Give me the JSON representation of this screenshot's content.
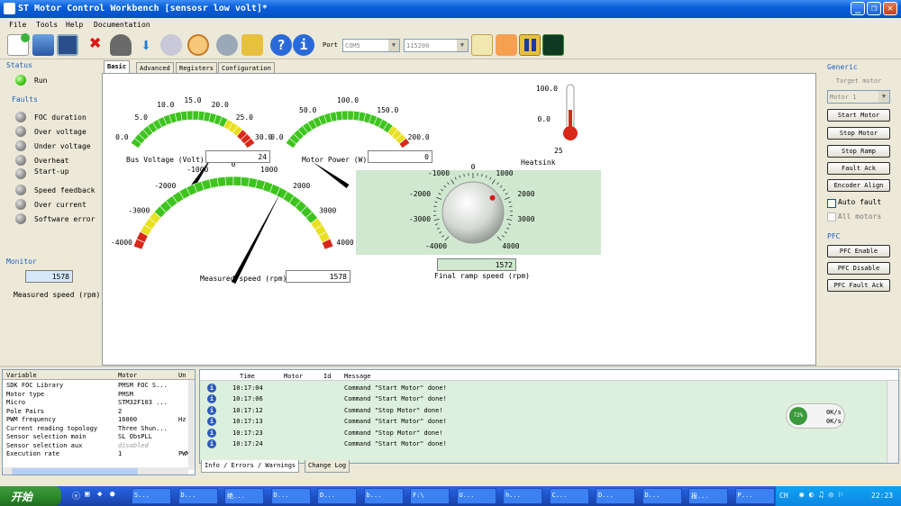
{
  "window": {
    "title": "ST Motor Control Workbench [sensosr low volt]*"
  },
  "menu": [
    "File",
    "Tools",
    "Help",
    "Documentation"
  ],
  "toolbar": {
    "port_label": "Port",
    "port_value": "COM5",
    "baud_value": "115200"
  },
  "status": {
    "group_label": "Status",
    "run_label": "Run",
    "faults_label": "Faults",
    "faults": [
      "FOC duration",
      "Over voltage",
      "Under voltage",
      "Overheat",
      "Start-up",
      "Speed feedback",
      "Over current",
      "Software error"
    ]
  },
  "monitor": {
    "group_label": "Monitor",
    "value": "1578",
    "caption": "Measured speed (rpm)"
  },
  "tabs": [
    "Basic",
    "Advanced",
    "Registers",
    "Configuration"
  ],
  "gauges": {
    "bus_voltage": {
      "label": "Bus Voltage (Volt)",
      "value": "24",
      "ticks": [
        "0.0",
        "5.0",
        "10.0",
        "15.0",
        "20.0",
        "25.0",
        "30.0"
      ],
      "reading": 24,
      "min": 0,
      "max": 30
    },
    "motor_power": {
      "label": "Motor Power (W)",
      "value": "0",
      "ticks": [
        "0.0",
        "50.0",
        "100.0",
        "150.0",
        "200.0"
      ],
      "reading": 0,
      "min": 0,
      "max": 200
    },
    "measured_speed": {
      "label": "Measured speed (rpm)",
      "value": "1578",
      "ticks": [
        "-4000",
        "-3000",
        "-2000",
        "-1000",
        "0",
        "1000",
        "2000",
        "3000",
        "4000"
      ],
      "reading": 1578,
      "min": -4000,
      "max": 4000
    },
    "heatsink": {
      "label": "Heatsink",
      "value": "25",
      "ticks": [
        "100.0",
        "0.0"
      ]
    },
    "final_ramp": {
      "label": "Final ramp speed (rpm)",
      "value": "1572",
      "ticks": [
        "-4000",
        "-3000",
        "-2000",
        "-1000",
        "0",
        "1000",
        "2000",
        "3000",
        "4000"
      ],
      "reading": 1572
    }
  },
  "right": {
    "generic_label": "Generic",
    "target_motor_label": "Target motor",
    "motor_select": "Motor 1",
    "buttons": [
      "Start Motor",
      "Stop Motor",
      "Stop Ramp",
      "Fault Ack",
      "Encoder Align"
    ],
    "auto_fault": "Auto fault",
    "all_motors": "All motors",
    "pfc_label": "PFC",
    "pfc_buttons": [
      "PFC Enable",
      "PFC Disable",
      "PFC Fault Ack"
    ]
  },
  "vartable": {
    "headers": [
      "Variable",
      "Motor",
      "Un"
    ],
    "rows": [
      [
        "SDK FOC Library",
        "PMSM FOC S...",
        ""
      ],
      [
        "Motor type",
        "PMSM",
        ""
      ],
      [
        "Micro",
        "STM32F103 ...",
        ""
      ],
      [
        "Pole Pairs",
        "2",
        ""
      ],
      [
        "PWM frequency",
        "16000",
        "Hz"
      ],
      [
        "Current reading topology",
        "Three Shun...",
        ""
      ],
      [
        "Sensor selection main",
        "SL ObsPLL",
        ""
      ],
      [
        "Sensor selection aux",
        "disabled",
        ""
      ],
      [
        "Execution rate",
        "1",
        "PWM"
      ]
    ]
  },
  "log": {
    "headers": [
      "Time",
      "Motor",
      "Id",
      "Message"
    ],
    "rows": [
      [
        "10:17:04",
        "Command \"Start Motor\" done!"
      ],
      [
        "10:17:06",
        "Command \"Start Motor\" done!"
      ],
      [
        "10:17:12",
        "Command \"Stop Motor\" done!"
      ],
      [
        "10:17:13",
        "Command \"Start Motor\" done!"
      ],
      [
        "10:17:23",
        "Command \"Stop Motor\" done!"
      ],
      [
        "10:17:24",
        "Command \"Start Motor\" done!"
      ]
    ],
    "tabs": [
      "Info / Errors / Warnings",
      "Change Log"
    ],
    "net_widget": {
      "percent": "72%",
      "up": "0K/s",
      "down": "0K/s"
    }
  },
  "taskbar": {
    "start_label": "开始",
    "tasks": [
      "S...",
      "D...",
      "绝...",
      "D...",
      "D...",
      "b...",
      "F:\\",
      "U...",
      "h...",
      "C...",
      "D...",
      "D...",
      "报...",
      "P..."
    ],
    "lang": "CH",
    "clock": "22:23"
  },
  "colors": {
    "title_blue": "#0a5fd8",
    "gauge_green": "#3ec41e",
    "gauge_yellow": "#e8e020",
    "gauge_red": "#d8281c",
    "knob_bg": "#cfe8cf",
    "log_bg": "#ddf0dd"
  }
}
